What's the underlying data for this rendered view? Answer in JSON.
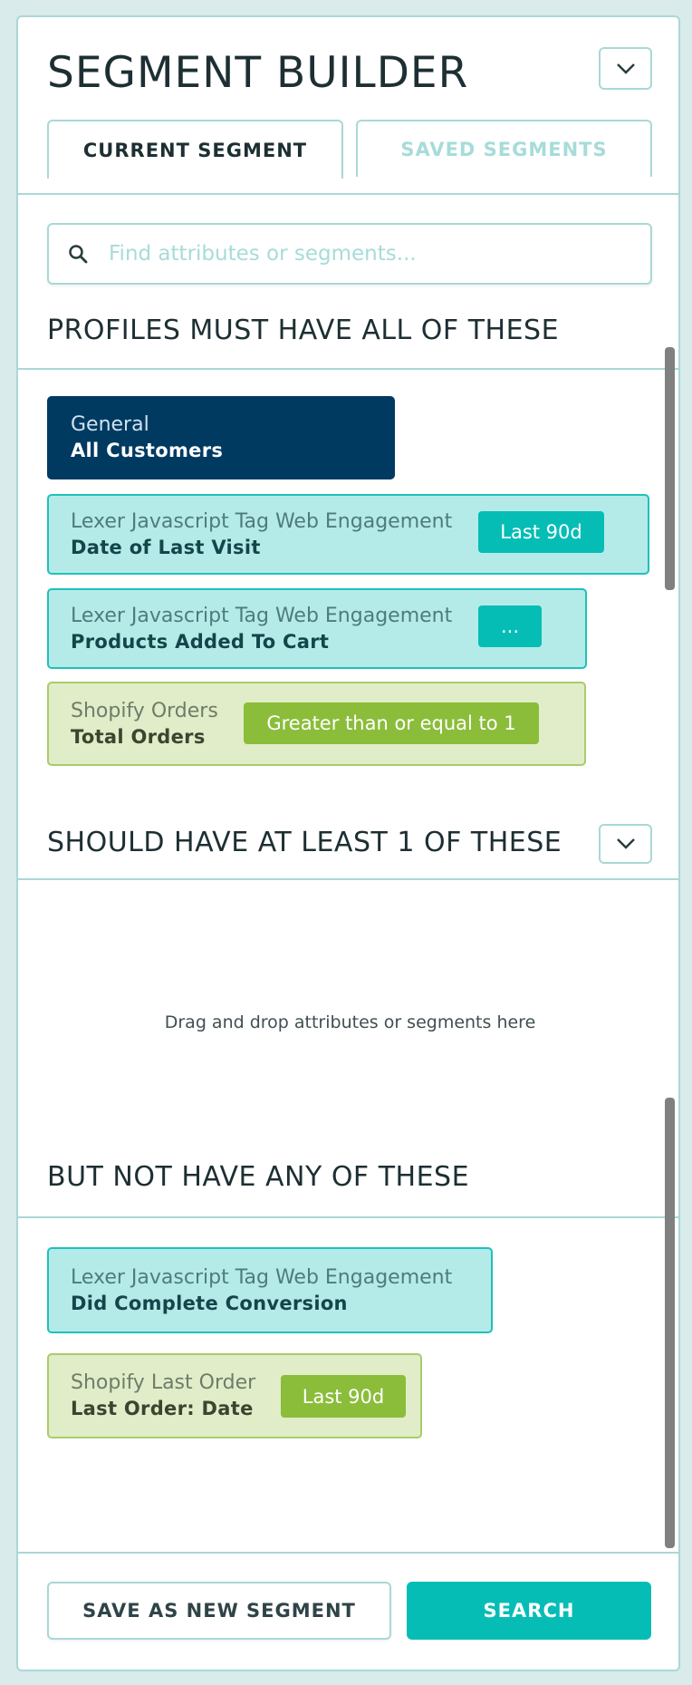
{
  "header": {
    "title": "SEGMENT BUILDER",
    "collapse_icon": "chevron-down-icon"
  },
  "tabs": [
    {
      "label": "CURRENT SEGMENT",
      "active": true
    },
    {
      "label": "SAVED SEGMENTS",
      "active": false
    }
  ],
  "search": {
    "placeholder": "Find attributes or segments...",
    "value": "",
    "icon": "search-icon"
  },
  "sections": {
    "must": {
      "title": "PROFILES MUST HAVE ALL OF THESE",
      "items": [
        {
          "category": "General",
          "attribute": "All Customers",
          "color": "navy"
        },
        {
          "category": "Lexer Javascript Tag Web Engagement",
          "attribute": "Date of Last Visit",
          "filter": "Last 90d",
          "color": "teal"
        },
        {
          "category": "Lexer Javascript Tag Web Engagement",
          "attribute": "Products Added To Cart",
          "filter": "...",
          "color": "teal"
        },
        {
          "category": "Shopify Orders",
          "attribute": "Total Orders",
          "filter": "Greater than or equal to 1",
          "color": "green"
        }
      ]
    },
    "should": {
      "title": "SHOULD HAVE AT LEAST 1 OF THESE",
      "dropzone_text": "Drag and drop attributes or segments here"
    },
    "not": {
      "title": "BUT NOT HAVE ANY OF THESE",
      "items": [
        {
          "category": "Lexer Javascript Tag Web Engagement",
          "attribute": "Did Complete Conversion",
          "color": "teal"
        },
        {
          "category": "Shopify Last Order",
          "attribute": "Last Order: Date",
          "filter": "Last 90d",
          "color": "green"
        }
      ]
    }
  },
  "footer": {
    "save_label": "SAVE AS NEW SEGMENT",
    "search_label": "SEARCH"
  },
  "colors": {
    "accent": "#06bdb6",
    "navy": "#003a61",
    "green": "#8bbd3a",
    "border": "#a9d8d6"
  }
}
